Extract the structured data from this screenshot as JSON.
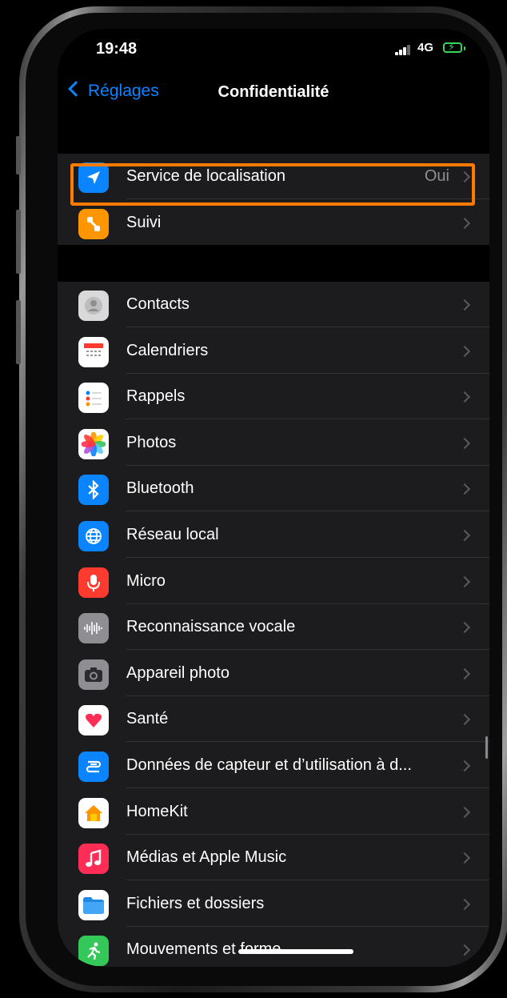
{
  "status": {
    "time": "19:48",
    "network": "4G",
    "battery_color": "#3bd45a"
  },
  "nav": {
    "back_label": "Réglages",
    "title": "Confidentialité"
  },
  "colors": {
    "accent": "#0a84ff",
    "highlight": "#ff7a00"
  },
  "section1": [
    {
      "label": "Service de localisation",
      "value": "Oui",
      "icon": "location-arrow-icon",
      "icon_color": "#0a84ff"
    },
    {
      "label": "Suivi",
      "icon": "tracking-icon",
      "icon_color": "#ff9500"
    }
  ],
  "section2": [
    {
      "label": "Contacts",
      "icon": "contacts-icon",
      "icon_color": "#d9d9d9"
    },
    {
      "label": "Calendriers",
      "icon": "calendar-icon",
      "icon_color": "#ffffff"
    },
    {
      "label": "Rappels",
      "icon": "reminders-icon",
      "icon_color": "#ffffff"
    },
    {
      "label": "Photos",
      "icon": "photos-icon",
      "icon_color": "#ffffff"
    },
    {
      "label": "Bluetooth",
      "icon": "bluetooth-icon",
      "icon_color": "#0a84ff"
    },
    {
      "label": "Réseau local",
      "icon": "globe-icon",
      "icon_color": "#0a84ff"
    },
    {
      "label": "Micro",
      "icon": "microphone-icon",
      "icon_color": "#ff3b30"
    },
    {
      "label": "Reconnaissance vocale",
      "icon": "waveform-icon",
      "icon_color": "#8e8e93"
    },
    {
      "label": "Appareil photo",
      "icon": "camera-icon",
      "icon_color": "#8e8e93"
    },
    {
      "label": "Santé",
      "icon": "heart-icon",
      "icon_color": "#ffffff"
    },
    {
      "label": "Données de capteur et d’utilisation à d...",
      "icon": "sensor-icon",
      "icon_color": "#0a84ff"
    },
    {
      "label": "HomeKit",
      "icon": "home-icon",
      "icon_color": "#ffffff"
    },
    {
      "label": "Médias et Apple Music",
      "icon": "music-icon",
      "icon_color": "#ff2d55"
    },
    {
      "label": "Fichiers et dossiers",
      "icon": "folder-icon",
      "icon_color": "#ffffff"
    },
    {
      "label": "Mouvements et forme",
      "icon": "fitness-icon",
      "icon_color": "#34c759"
    }
  ]
}
